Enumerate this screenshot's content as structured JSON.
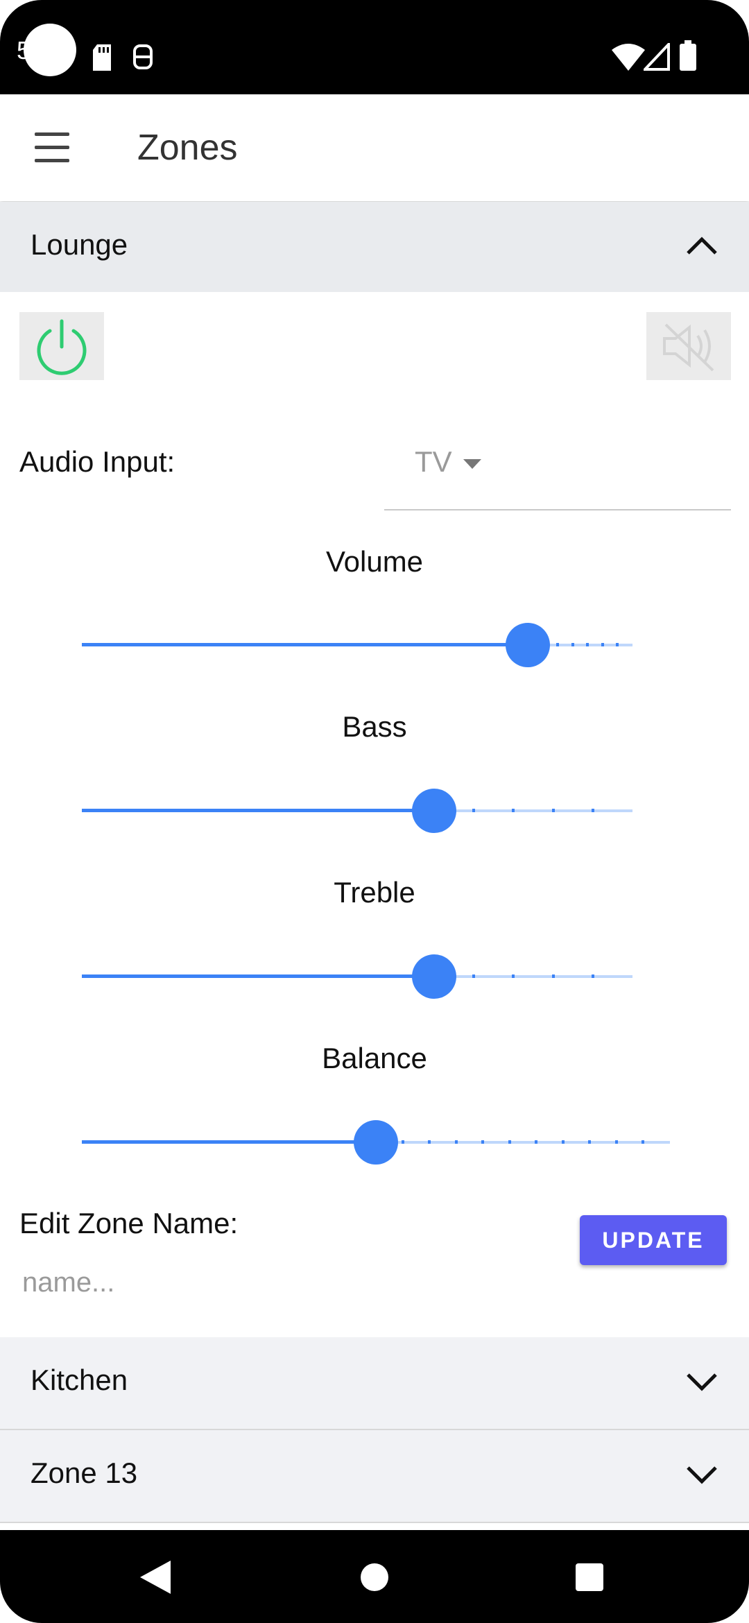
{
  "status_bar": {
    "time": "5"
  },
  "app_bar": {
    "title": "Zones"
  },
  "zones": [
    {
      "name": "Lounge",
      "expanded": true
    },
    {
      "name": "Kitchen",
      "expanded": false
    },
    {
      "name": "Zone 13",
      "expanded": false
    }
  ],
  "lounge": {
    "power_icon": "power-icon",
    "mute_icon": "volume-mute-icon",
    "audio_input_label": "Audio Input:",
    "audio_input_value": "TV",
    "sliders": [
      {
        "label": "Volume",
        "value": 0.81,
        "ticks": 6
      },
      {
        "label": "Bass",
        "value": 0.64,
        "ticks": 4
      },
      {
        "label": "Treble",
        "value": 0.64,
        "ticks": 4
      },
      {
        "label": "Balance",
        "value": 0.5,
        "ticks": 10
      }
    ],
    "edit_zone_name_label": "Edit Zone Name:",
    "zone_name_placeholder": "name...",
    "update_label": "UPDATE"
  },
  "colors": {
    "accent": "#3b82f6",
    "power_on": "#2ecc71",
    "update_button": "#5c5cf2",
    "accordion_header": "#e9ebee"
  }
}
